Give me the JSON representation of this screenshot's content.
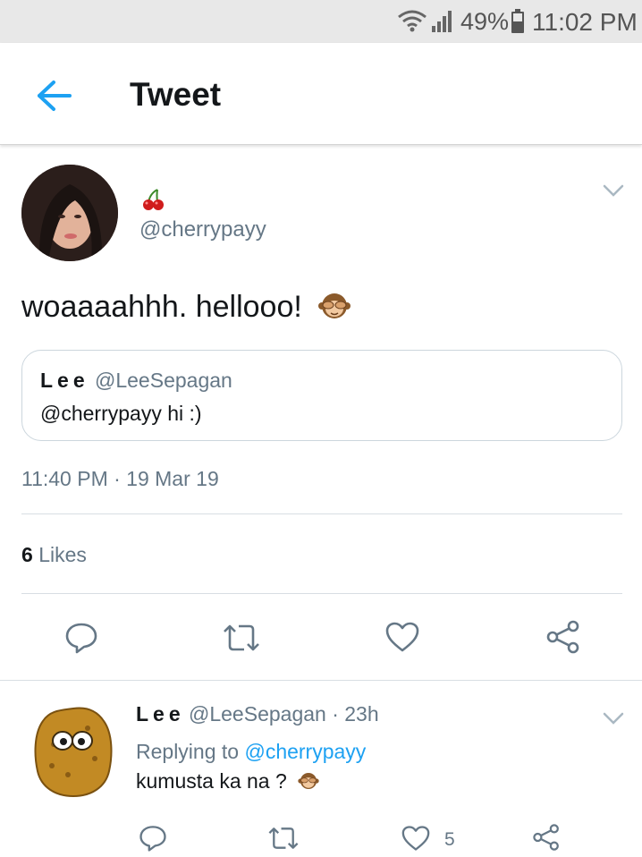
{
  "status_bar": {
    "battery": "49%",
    "time": "11:02 PM"
  },
  "header": {
    "title": "Tweet"
  },
  "tweet": {
    "handle": "@cherrypayy",
    "text": "woaaaahhh. hellooo!",
    "quote": {
      "name": "Lee",
      "handle": "@LeeSepagan",
      "text": "@cherrypayy hi :)"
    },
    "timestamp": "11:40 PM · 19 Mar 19",
    "likes_count": "6",
    "likes_label": "Likes"
  },
  "reply": {
    "name": "Lee",
    "handle_time": "@LeeSepagan · 23h",
    "replying_prefix": "Replying to",
    "replying_to": "@cherrypayy",
    "text": "kumusta ka na ?",
    "like_count": "5"
  },
  "colors": {
    "accent": "#1da1f2",
    "secondary_text": "#657786",
    "divider": "#d8dee3"
  },
  "icons": {
    "status": [
      "wifi-icon",
      "signal-icon",
      "battery-icon"
    ],
    "header": [
      "back-arrow-icon"
    ],
    "actions": [
      "reply-icon",
      "retweet-icon",
      "like-icon",
      "share-icon"
    ],
    "other": [
      "cherry-emoji",
      "see-no-evil-monkey-emoji",
      "chevron-down-icon"
    ]
  }
}
